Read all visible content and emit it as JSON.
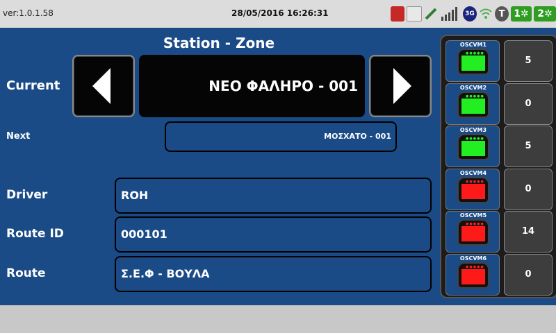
{
  "status_bar": {
    "version": "ver:1.0.1.58",
    "datetime": "28/05/2016 16:26:31",
    "icons": [
      {
        "name": "alarm-icon",
        "text": "",
        "color": "#c62828"
      },
      {
        "name": "card-reader-icon",
        "text": "",
        "color": "#1565c0"
      },
      {
        "name": "connection-icon",
        "text": "",
        "color": "#2e7d32"
      },
      {
        "name": "signal-bars-icon",
        "text": "",
        "color": "#444444"
      },
      {
        "name": "network-3g-icon",
        "text": "3G",
        "color": "#1a237e"
      },
      {
        "name": "wifi-icon",
        "text": "",
        "color": "#4caf50"
      },
      {
        "name": "t-icon",
        "text": "T",
        "color": "#333333"
      },
      {
        "name": "fan-1-icon",
        "text": "1",
        "color": "#2e9d22"
      },
      {
        "name": "fan-2-icon",
        "text": "2",
        "color": "#2e9d22"
      }
    ]
  },
  "main": {
    "title": "Station - Zone",
    "labels": {
      "current": "Current",
      "next": "Next",
      "driver": "Driver",
      "route_id": "Route ID",
      "route": "Route"
    },
    "current_station": "ΝΕΟ ΦΑΛΗΡΟ  -  001",
    "next_station": "ΜΟΣΧΑΤΟ  -  001",
    "driver": "ROH",
    "route_id": "000101",
    "route": "Σ.Ε.Φ - ΒΟΥΛΑ"
  },
  "validators": [
    {
      "name": "OSCVM1",
      "count": "5",
      "color": "#22ee22"
    },
    {
      "name": "OSCVM2",
      "count": "0",
      "color": "#22ee22"
    },
    {
      "name": "OSCVM3",
      "count": "5",
      "color": "#22ee22"
    },
    {
      "name": "OSCVM4",
      "count": "0",
      "color": "#ff1a1a"
    },
    {
      "name": "OSCVM5",
      "count": "14",
      "color": "#ff1a1a"
    },
    {
      "name": "OSCVM6",
      "count": "0",
      "color": "#ff1a1a"
    }
  ],
  "colors": {
    "panel_blue": "#1a4b86",
    "dark": "#050505"
  }
}
